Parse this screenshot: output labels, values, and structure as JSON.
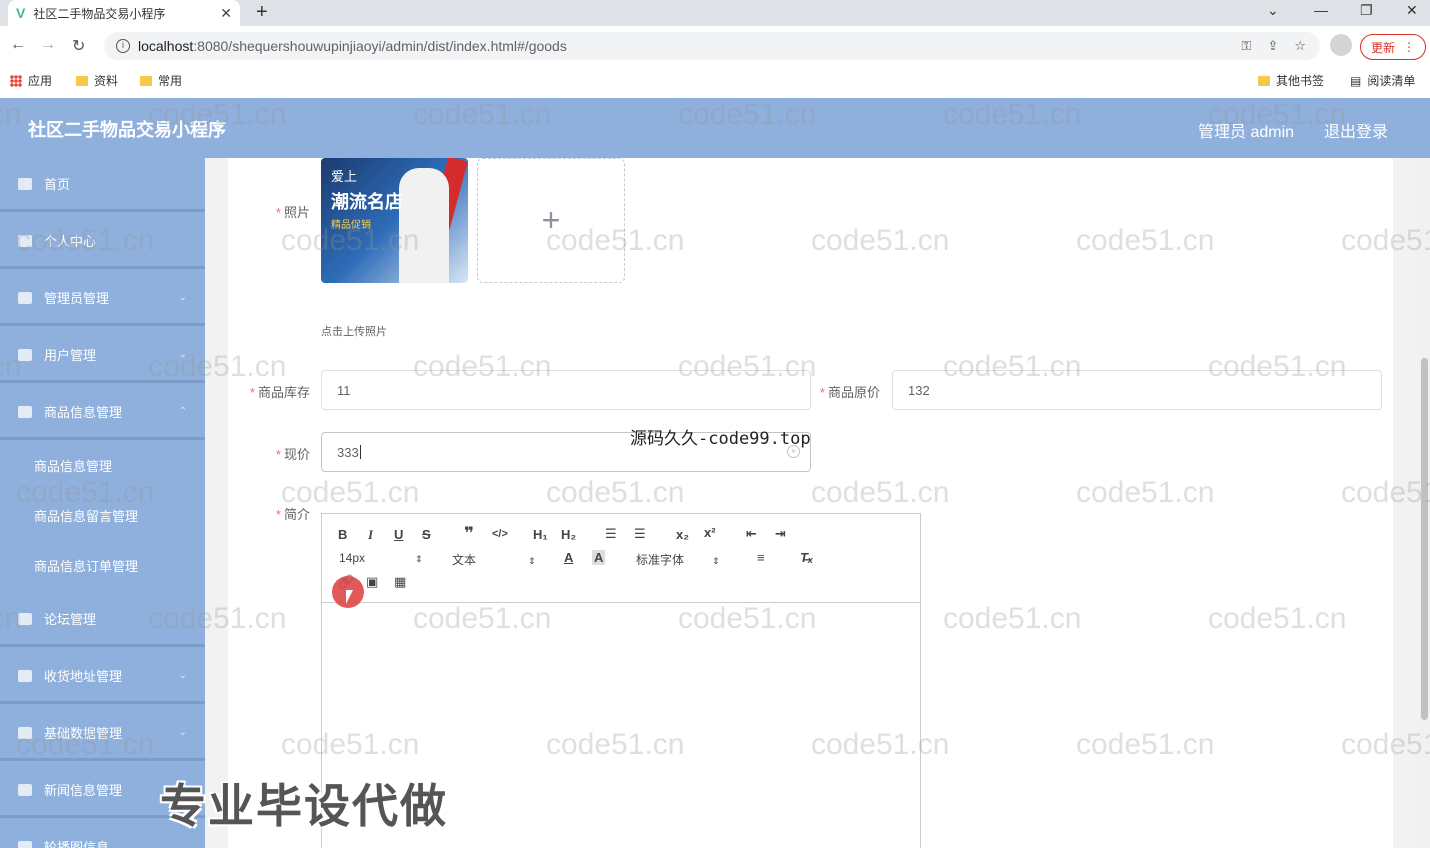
{
  "browser": {
    "tab_title": "社区二手物品交易小程序",
    "url_host": "localhost",
    "url_path": ":8080/shequershouwupinjiaoyi/admin/dist/index.html#/goods",
    "update_label": "更新",
    "bookmarks": [
      "应用",
      "资料",
      "常用"
    ],
    "other_bookmarks": "其他书签",
    "reading_list": "阅读清单"
  },
  "header": {
    "title": "社区二手物品交易小程序",
    "user": "管理员 admin",
    "logout": "退出登录"
  },
  "sidebar": {
    "items": [
      {
        "label": "首页"
      },
      {
        "label": "个人中心"
      },
      {
        "label": "管理员管理"
      },
      {
        "label": "用户管理"
      },
      {
        "label": "商品信息管理"
      },
      {
        "label": "论坛管理"
      },
      {
        "label": "收货地址管理"
      },
      {
        "label": "基础数据管理"
      },
      {
        "label": "新闻信息管理"
      },
      {
        "label": "轮播图信息"
      }
    ],
    "subitems": [
      {
        "label": "商品信息管理"
      },
      {
        "label": "商品信息留言管理"
      },
      {
        "label": "商品信息订单管理"
      }
    ]
  },
  "form": {
    "photo_label": "照片",
    "photo_banner_line1": "爱上",
    "photo_banner_line2": "潮流名店",
    "photo_banner_line3": "精品促销",
    "upload_plus": "+",
    "upload_hint": "点击上传照片",
    "stock_label": "商品库存",
    "stock_value": "11",
    "original_price_label": "商品原价",
    "original_price_value": "132",
    "price_label": "现价",
    "price_value": "333",
    "intro_label": "简介"
  },
  "editor": {
    "font_size": "14px",
    "text_type": "文本",
    "font_family": "标准字体"
  },
  "watermarks": {
    "repeat": "code51.cn",
    "center": "源码久久-code99.top",
    "big": "专业毕设代做"
  }
}
